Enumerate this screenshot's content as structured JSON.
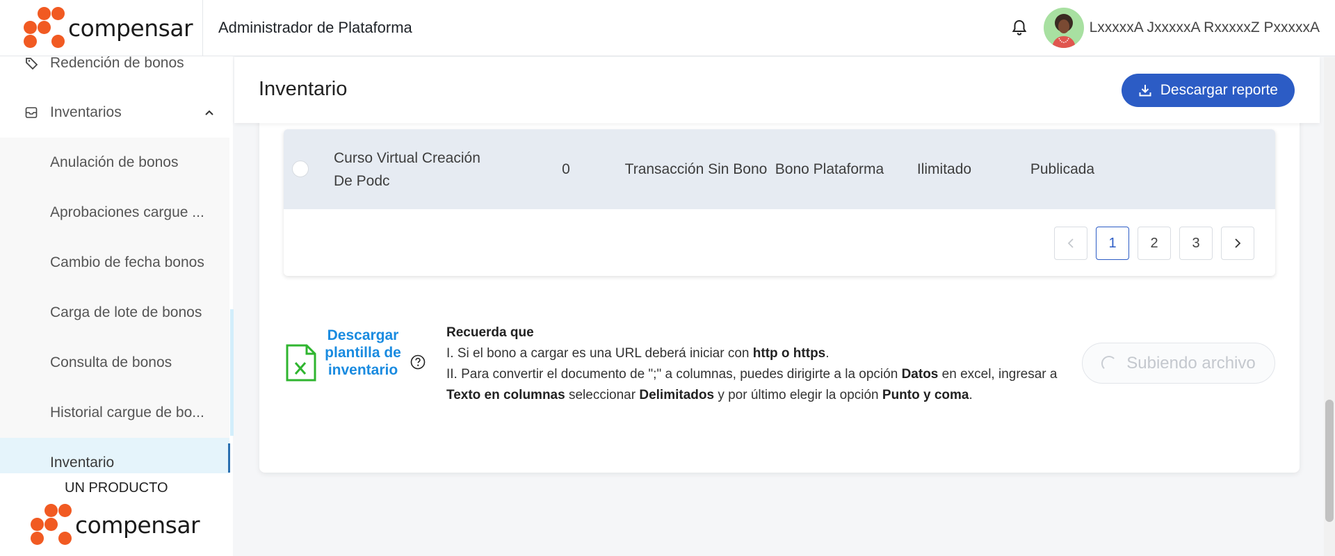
{
  "header": {
    "logo_text": "compensar",
    "app_title": "Administrador de Plataforma",
    "user_name": "LxxxxxA JxxxxxA RxxxxxZ PxxxxxA"
  },
  "sidebar": {
    "items": [
      {
        "label": "Redención de bonos",
        "icon": "tag-icon"
      },
      {
        "label": "Inventarios",
        "icon": "inventory-box-icon",
        "expanded": true
      }
    ],
    "sub_items": [
      {
        "label": "Anulación de bonos"
      },
      {
        "label": "Aprobaciones cargue ..."
      },
      {
        "label": "Cambio de fecha bonos"
      },
      {
        "label": "Carga de lote de bonos"
      },
      {
        "label": "Consulta de bonos"
      },
      {
        "label": "Historial cargue de bo..."
      },
      {
        "label": "Inventario",
        "active": true
      }
    ],
    "footer_label": "UN PRODUCTO",
    "footer_logo_text": "compensar"
  },
  "main": {
    "page_title": "Inventario",
    "download_label": "Descargar reporte",
    "table": {
      "rows": [
        {
          "name": "Curso Virtual Creación De Podc",
          "quantity": "0",
          "transaction_type": "Transacción Sin Bono",
          "bono_type": "Bono Plataforma",
          "limit": "Ilimitado",
          "status": "Publicada"
        }
      ]
    },
    "pagination": {
      "pages": [
        "1",
        "2",
        "3"
      ],
      "current": "1"
    },
    "template_link": "Descargar plantilla de inventario",
    "notes": {
      "title": "Recuerda que",
      "line1_prefix": "I. Si el bono a cargar es una URL deberá iniciar con ",
      "line1_bold": "http o https",
      "line1_suffix": ".",
      "line2_a": "II. Para convertir el documento de \";\" a columnas, puedes dirigirte a la opción ",
      "line2_b": "Datos",
      "line2_c": " en excel, ingresar a ",
      "line2_d": "Texto en columnas",
      "line2_e": " seleccionar ",
      "line2_f": "Delimitados",
      "line2_g": " y por último elegir la opción ",
      "line2_h": "Punto y coma",
      "line2_i": "."
    },
    "upload_label": "Subiendo archivo"
  },
  "colors": {
    "brand_orange": "#f15a22",
    "primary_blue": "#2c5cc5",
    "link_blue": "#1a8be0",
    "excel_green": "#2fb52f"
  }
}
